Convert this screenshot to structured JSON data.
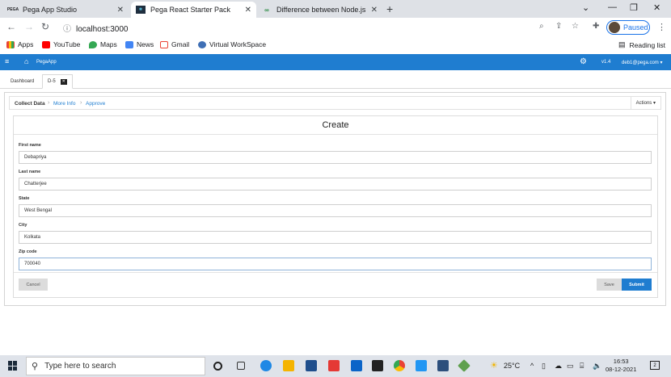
{
  "browser": {
    "tabs": [
      {
        "favicon": "PEGA",
        "title": "Pega App Studio"
      },
      {
        "favicon": "react",
        "title": "Pega React Starter Pack"
      },
      {
        "favicon": "geeks",
        "title": "Difference between Node.js and"
      }
    ],
    "url": "localhost:3000",
    "profile_label": "Paused",
    "bookmarks": [
      "Apps",
      "YouTube",
      "Maps",
      "News",
      "Gmail",
      "Virtual WorkSpace"
    ],
    "reading_list": "Reading list"
  },
  "app": {
    "name": "PegaApp",
    "version": "v1.4",
    "user": "deb1@pega.com",
    "worktabs": [
      "Dashboard",
      "D-5"
    ]
  },
  "case": {
    "stages": [
      "Collect Data",
      "More Info",
      "Approve"
    ],
    "actions_label": "Actions",
    "form_title": "Create",
    "fields": [
      {
        "label": "First name",
        "value": "Debapriya"
      },
      {
        "label": "Last name",
        "value": "Chatterjee"
      },
      {
        "label": "State",
        "value": "West Bengal"
      },
      {
        "label": "City",
        "value": "Kolkata"
      },
      {
        "label": "Zip code",
        "value": "700040"
      }
    ],
    "buttons": {
      "cancel": "Cancel",
      "save": "Save",
      "submit": "Submit"
    }
  },
  "taskbar": {
    "search_placeholder": "Type here to search",
    "weather": "25°C",
    "time": "16:53",
    "date": "08-12-2021",
    "notification_count": "2"
  }
}
